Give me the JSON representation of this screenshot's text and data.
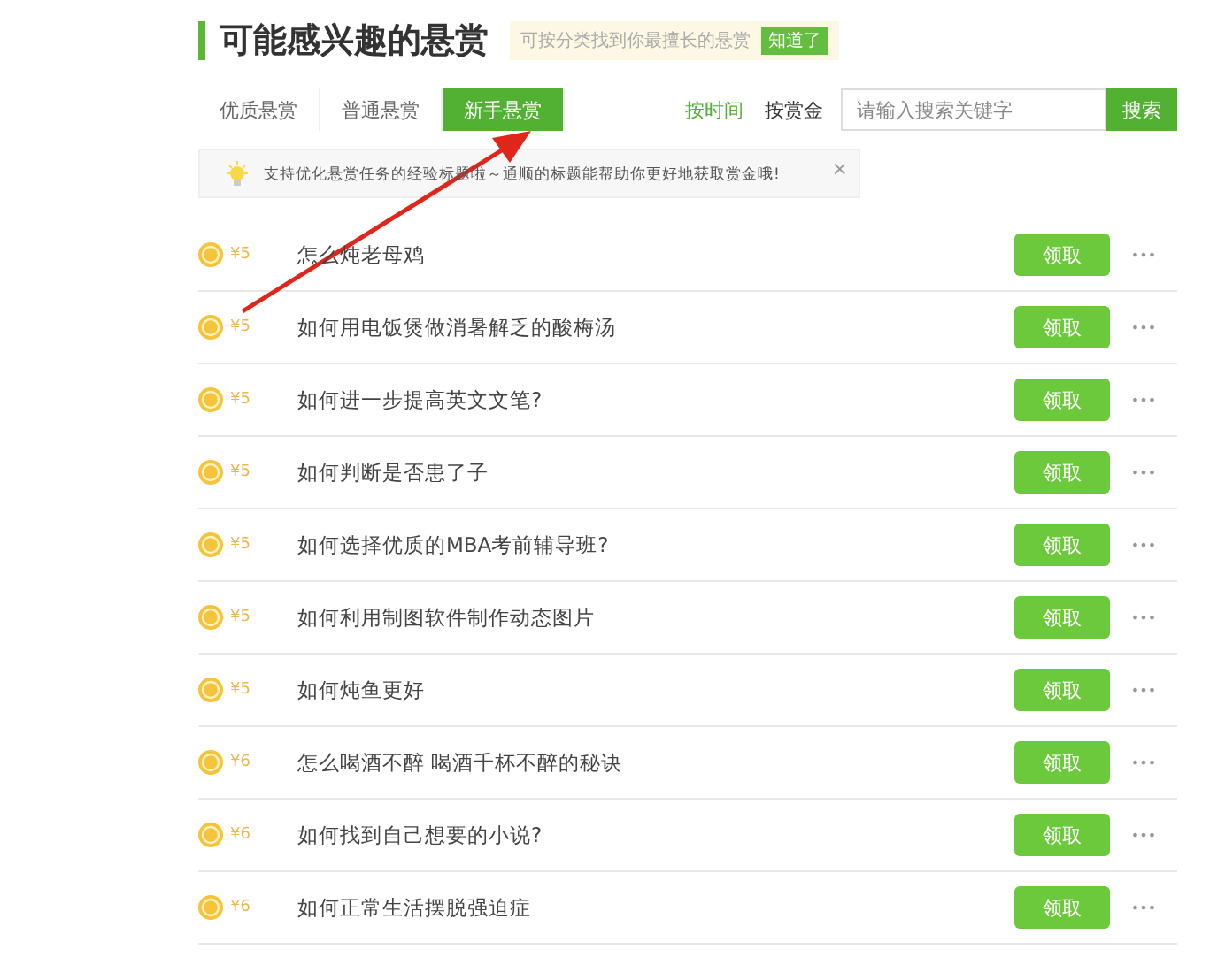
{
  "title": "可能感兴趣的悬赏",
  "hint": {
    "text": "可按分类找到你最擅长的悬赏",
    "button": "知道了"
  },
  "tabs": [
    {
      "label": "优质悬赏",
      "selected": false
    },
    {
      "label": "普通悬赏",
      "selected": false
    },
    {
      "label": "新手悬赏",
      "selected": true
    }
  ],
  "sorts": [
    {
      "label": "按时间",
      "selected": true
    },
    {
      "label": "按赏金",
      "selected": false
    }
  ],
  "search": {
    "placeholder": "请输入搜索关键字",
    "button": "搜索"
  },
  "tip": {
    "text": "支持优化悬赏任务的经验标题啦～通顺的标题能帮助你更好地获取赏金哦!",
    "close": "×"
  },
  "rows": [
    {
      "reward": "¥5",
      "question": "怎么炖老母鸡",
      "action": "领取",
      "more": "•••"
    },
    {
      "reward": "¥5",
      "question": "如何用电饭煲做消暑解乏的酸梅汤",
      "action": "领取",
      "more": "•••"
    },
    {
      "reward": "¥5",
      "question": "如何进一步提高英文文笔?",
      "action": "领取",
      "more": "•••"
    },
    {
      "reward": "¥5",
      "question": "如何判断是否患了子",
      "action": "领取",
      "more": "•••"
    },
    {
      "reward": "¥5",
      "question": "如何选择优质的MBA考前辅导班?",
      "action": "领取",
      "more": "•••"
    },
    {
      "reward": "¥5",
      "question": "如何利用制图软件制作动态图片",
      "action": "领取",
      "more": "•••"
    },
    {
      "reward": "¥5",
      "question": "如何炖鱼更好",
      "action": "领取",
      "more": "•••"
    },
    {
      "reward": "¥6",
      "question": "怎么喝酒不醉 喝酒千杯不醉的秘诀",
      "action": "领取",
      "more": "•••"
    },
    {
      "reward": "¥6",
      "question": "如何找到自己想要的小说?",
      "action": "领取",
      "more": "•••"
    },
    {
      "reward": "¥6",
      "question": "如何正常生活摆脱强迫症",
      "action": "领取",
      "more": "•••"
    }
  ]
}
